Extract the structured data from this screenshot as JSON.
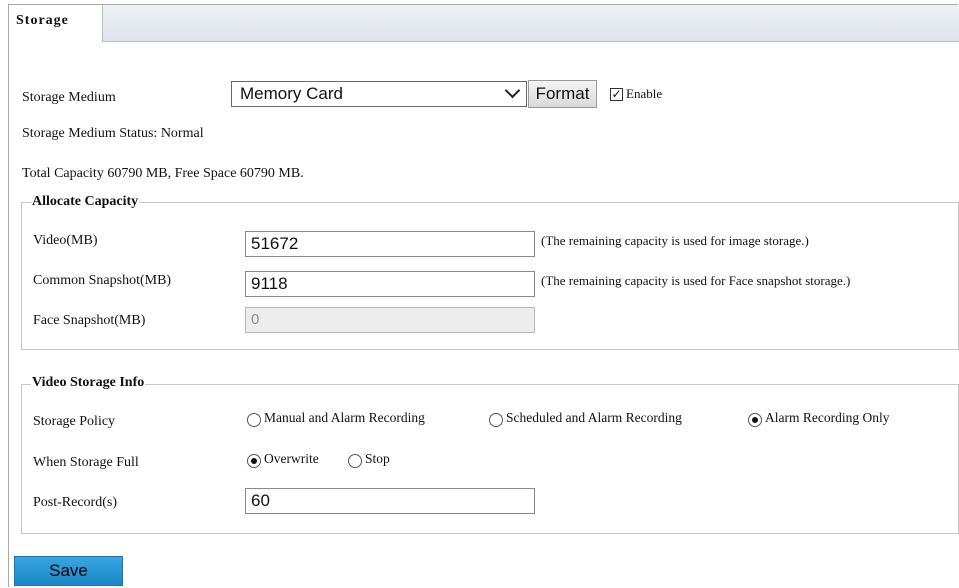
{
  "tab": {
    "label": "Storage"
  },
  "storage": {
    "medium_label": "Storage Medium",
    "medium_value": "Memory Card",
    "format_label": "Format",
    "enable_label": "Enable",
    "enable_checked": true,
    "status_text": "Storage Medium Status:  Normal",
    "capacity_text": "Total Capacity  60790  MB,  Free Space  60790  MB."
  },
  "allocate": {
    "title": "Allocate Capacity",
    "video_label": "Video(MB)",
    "video_value": "51672",
    "video_note": "(The remaining capacity is used for image storage.)",
    "common_label": "Common Snapshot(MB)",
    "common_value": "9118",
    "common_note": "(The remaining capacity is used for Face snapshot storage.)",
    "face_label": "Face Snapshot(MB)",
    "face_value": "0"
  },
  "video_info": {
    "title": "Video Storage Info",
    "policy_label": "Storage Policy",
    "policy_options": [
      "Manual and Alarm Recording",
      "Scheduled and Alarm Recording",
      "Alarm Recording Only"
    ],
    "policy_selected": "Alarm Recording Only",
    "full_label": "When Storage Full",
    "full_options": [
      "Overwrite",
      "Stop"
    ],
    "full_selected": "Overwrite",
    "post_label": "Post-Record(s)",
    "post_value": "60"
  },
  "actions": {
    "save_label": "Save"
  },
  "colors": {
    "save_button": "#2594d6",
    "tab_bar": "#e4e8ee",
    "group_border": "#c8c8c8"
  }
}
